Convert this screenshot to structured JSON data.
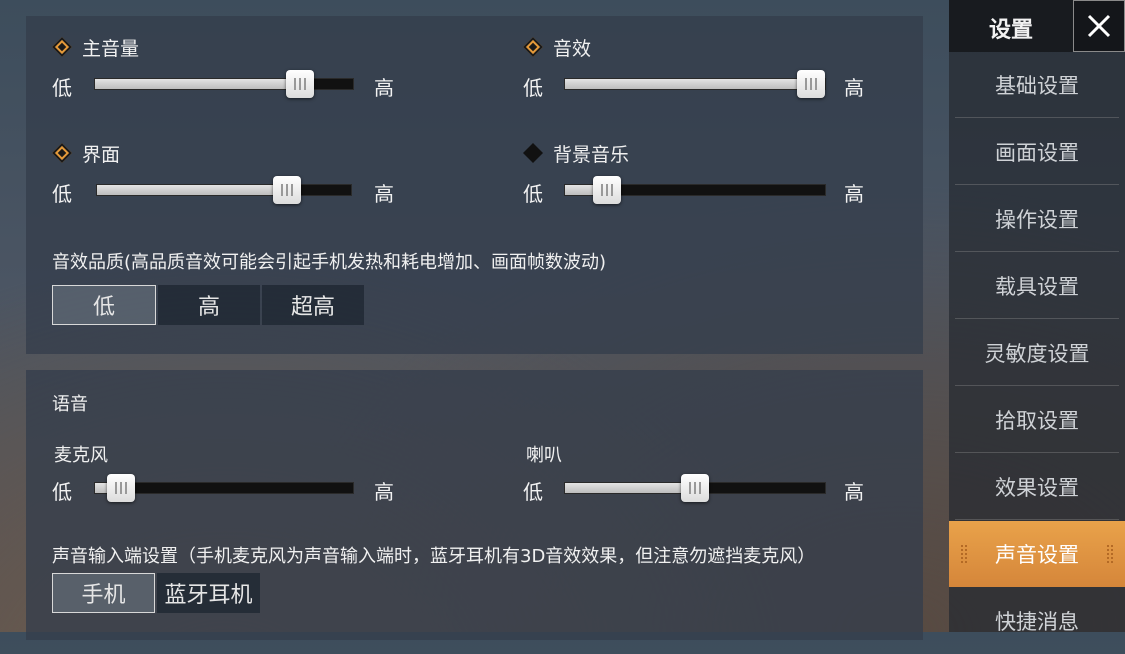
{
  "volume": {
    "low_label": "低",
    "high_label": "高",
    "sliders": [
      {
        "label": "主音量",
        "value": 0.83,
        "enabled": true
      },
      {
        "label": "音效",
        "value": 1.0,
        "enabled": true
      },
      {
        "label": "界面",
        "value": 0.78,
        "enabled": true
      },
      {
        "label": "背景音乐",
        "value": 0.12,
        "enabled": false
      }
    ],
    "quality": {
      "description": "音效品质(高品质音效可能会引起手机发热和耗电增加、画面帧数波动)",
      "options": [
        "低",
        "高",
        "超高"
      ],
      "selected": "低"
    }
  },
  "voice": {
    "section_title": "语音",
    "sliders": [
      {
        "label": "麦克风",
        "value": 0.05
      },
      {
        "label": "喇叭",
        "value": 0.5
      }
    ],
    "input": {
      "description": "声音输入端设置（手机麦克风为声音输入端时，蓝牙耳机有3D音效效果，但注意勿遮挡麦克风）",
      "options": [
        "手机",
        "蓝牙耳机"
      ],
      "selected": "手机"
    }
  },
  "sidebar": {
    "title": "设置",
    "close_icon": "close-icon",
    "items": [
      {
        "label": "基础设置"
      },
      {
        "label": "画面设置"
      },
      {
        "label": "操作设置"
      },
      {
        "label": "载具设置"
      },
      {
        "label": "灵敏度设置"
      },
      {
        "label": "拾取设置"
      },
      {
        "label": "效果设置"
      },
      {
        "label": "声音设置",
        "active": true
      },
      {
        "label": "快捷消息"
      }
    ]
  },
  "colors": {
    "accent": "#e59a3a",
    "active_tab": "#d5863a",
    "panel": "#343e4c"
  }
}
